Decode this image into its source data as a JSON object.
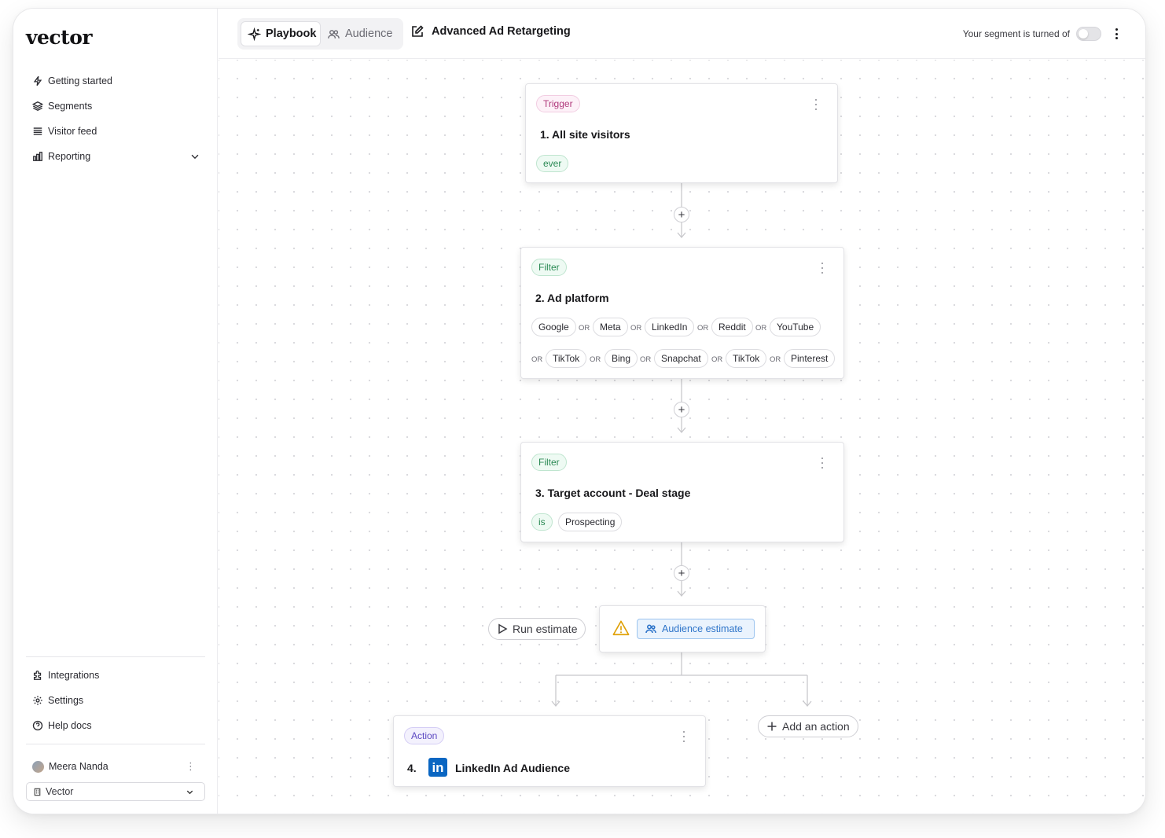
{
  "app": {
    "logo": "vector"
  },
  "sidebar": {
    "nav_top": [
      {
        "label": "Getting started",
        "icon": "lightning-icon"
      },
      {
        "label": "Segments",
        "icon": "layers-icon"
      },
      {
        "label": "Visitor feed",
        "icon": "list-icon"
      },
      {
        "label": "Reporting",
        "icon": "bar-chart-icon"
      }
    ],
    "nav_bottom": [
      {
        "label": "Integrations",
        "icon": "puzzle-icon"
      },
      {
        "label": "Settings",
        "icon": "gear-icon"
      },
      {
        "label": "Help docs",
        "icon": "help-circle-icon"
      }
    ],
    "user_name": "Meera Nanda",
    "workspace": "Vector"
  },
  "topbar": {
    "tab_playbook": "Playbook",
    "tab_audience": "Audience",
    "title": "Advanced Ad Retargeting",
    "status_text": "Your segment is turned of"
  },
  "flow": {
    "trigger": {
      "badge": "Trigger",
      "title": "1. All site visitors",
      "chip": "ever"
    },
    "filter1": {
      "badge": "Filter",
      "title": "2. Ad platform",
      "or_label": "OR",
      "row1": [
        "Google",
        "Meta",
        "LinkedIn",
        "Reddit",
        "YouTube"
      ],
      "row2": [
        "TikTok",
        "Bing",
        "Snapchat",
        "TikTok",
        "Pinterest"
      ]
    },
    "filter2": {
      "badge": "Filter",
      "title": "3. Target account - Deal stage",
      "operator": "is",
      "value": "Prospecting"
    },
    "estimate": {
      "run_label": "Run estimate",
      "audience_label": "Audience estimate"
    },
    "action": {
      "badge": "Action",
      "number": "4.",
      "title": "LinkedIn Ad Audience",
      "logo_text": "in"
    },
    "add_action_label": "Add an action"
  },
  "colors": {
    "trigger": "#b0397c",
    "filter": "#2c8a55",
    "action": "#5c48c2",
    "audience_blue": "#2e74c9",
    "linkedin": "#0a66c2",
    "warning": "#e0a106"
  }
}
